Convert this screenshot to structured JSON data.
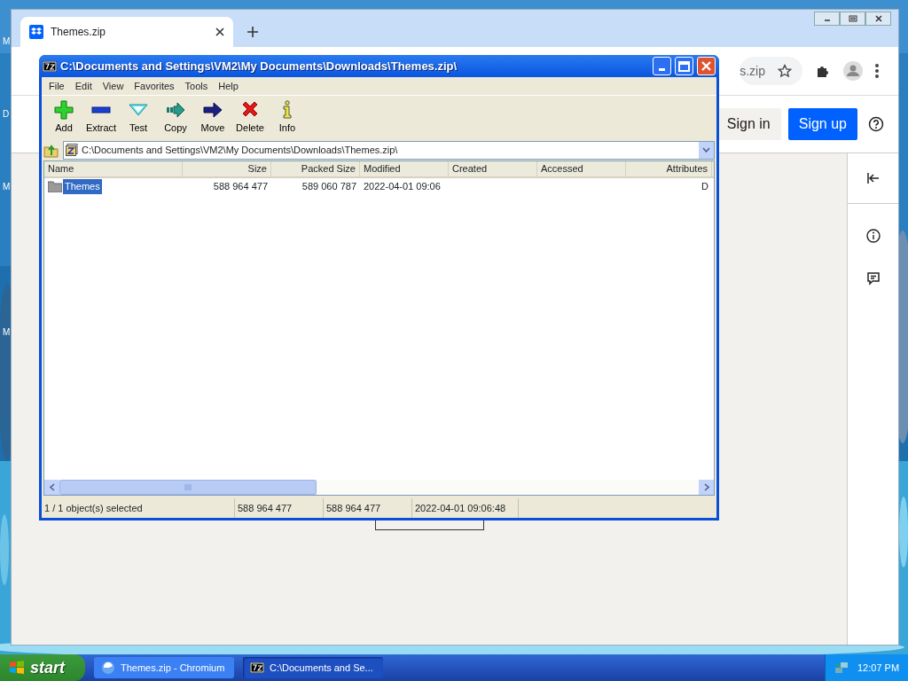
{
  "desktop": {
    "edge_labels": [
      "M",
      "D",
      "M",
      "M"
    ]
  },
  "browser": {
    "tabs": [
      {
        "label": "Themes.zip",
        "selected": true
      }
    ],
    "address_fragment": "s.zip",
    "sign_in": "Sign in",
    "sign_up": "Sign up"
  },
  "archiver": {
    "title": "C:\\Documents and Settings\\VM2\\My Documents\\Downloads\\Themes.zip\\",
    "menu": [
      "File",
      "Edit",
      "View",
      "Favorites",
      "Tools",
      "Help"
    ],
    "toolbar": [
      {
        "label": "Add",
        "kind": "add"
      },
      {
        "label": "Extract",
        "kind": "extract"
      },
      {
        "label": "Test",
        "kind": "test"
      },
      {
        "label": "Copy",
        "kind": "copy"
      },
      {
        "label": "Move",
        "kind": "move"
      },
      {
        "label": "Delete",
        "kind": "delete"
      },
      {
        "label": "Info",
        "kind": "info"
      }
    ],
    "path": "C:\\Documents and Settings\\VM2\\My Documents\\Downloads\\Themes.zip\\",
    "columns": [
      "Name",
      "Size",
      "Packed Size",
      "Modified",
      "Created",
      "Accessed",
      "Attributes"
    ],
    "rows": [
      {
        "name": "Themes",
        "size": "588 964 477",
        "packed_size": "589 060 787",
        "modified": "2022-04-01 09:06",
        "attributes": "D",
        "selected": true
      }
    ],
    "status_bar": [
      "1 / 1 object(s) selected",
      "588 964 477",
      "588 964 477",
      "2022-04-01 09:06:48"
    ]
  },
  "taskbar": {
    "start": "start",
    "tasks": [
      {
        "label": "Themes.zip - Chromium",
        "kind": "browser",
        "selected": false
      },
      {
        "label": "C:\\Documents and Se...",
        "kind": "archiver",
        "selected": true
      }
    ],
    "clock": "12:07 PM"
  }
}
